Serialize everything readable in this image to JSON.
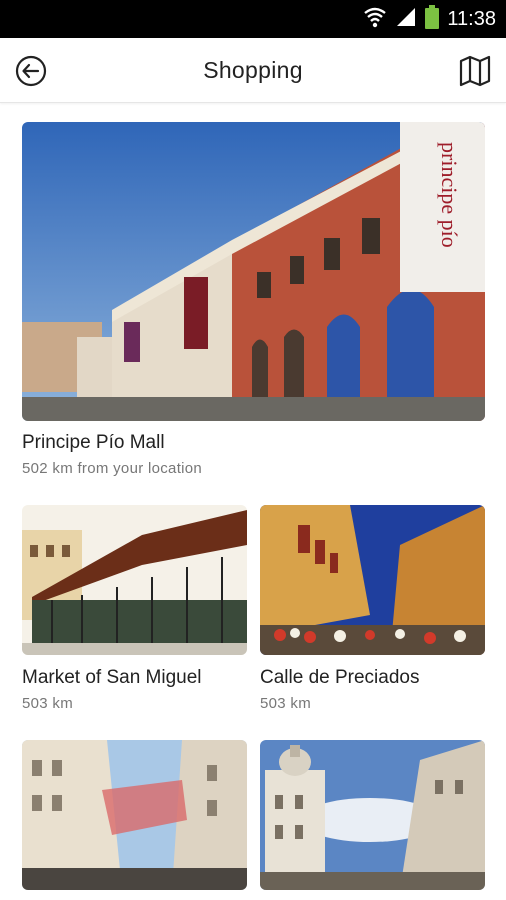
{
  "status_bar": {
    "time": "11:38",
    "icons": [
      "wifi-icon",
      "signal-icon",
      "battery-icon"
    ]
  },
  "header": {
    "title": "Shopping",
    "back_icon": "back-arrow-icon",
    "map_icon": "map-icon"
  },
  "featured": {
    "name": "Principe Pío Mall",
    "distance": "502 km from your location",
    "sign_text": "principe pío"
  },
  "places": [
    {
      "name": "Market of San Miguel",
      "distance": "503 km"
    },
    {
      "name": "Calle de Preciados",
      "distance": "503 km"
    },
    {
      "name": "",
      "distance": ""
    },
    {
      "name": "",
      "distance": ""
    }
  ],
  "colors": {
    "accent_green": "#7cc142",
    "text_primary": "#222222",
    "text_secondary": "#777777"
  }
}
